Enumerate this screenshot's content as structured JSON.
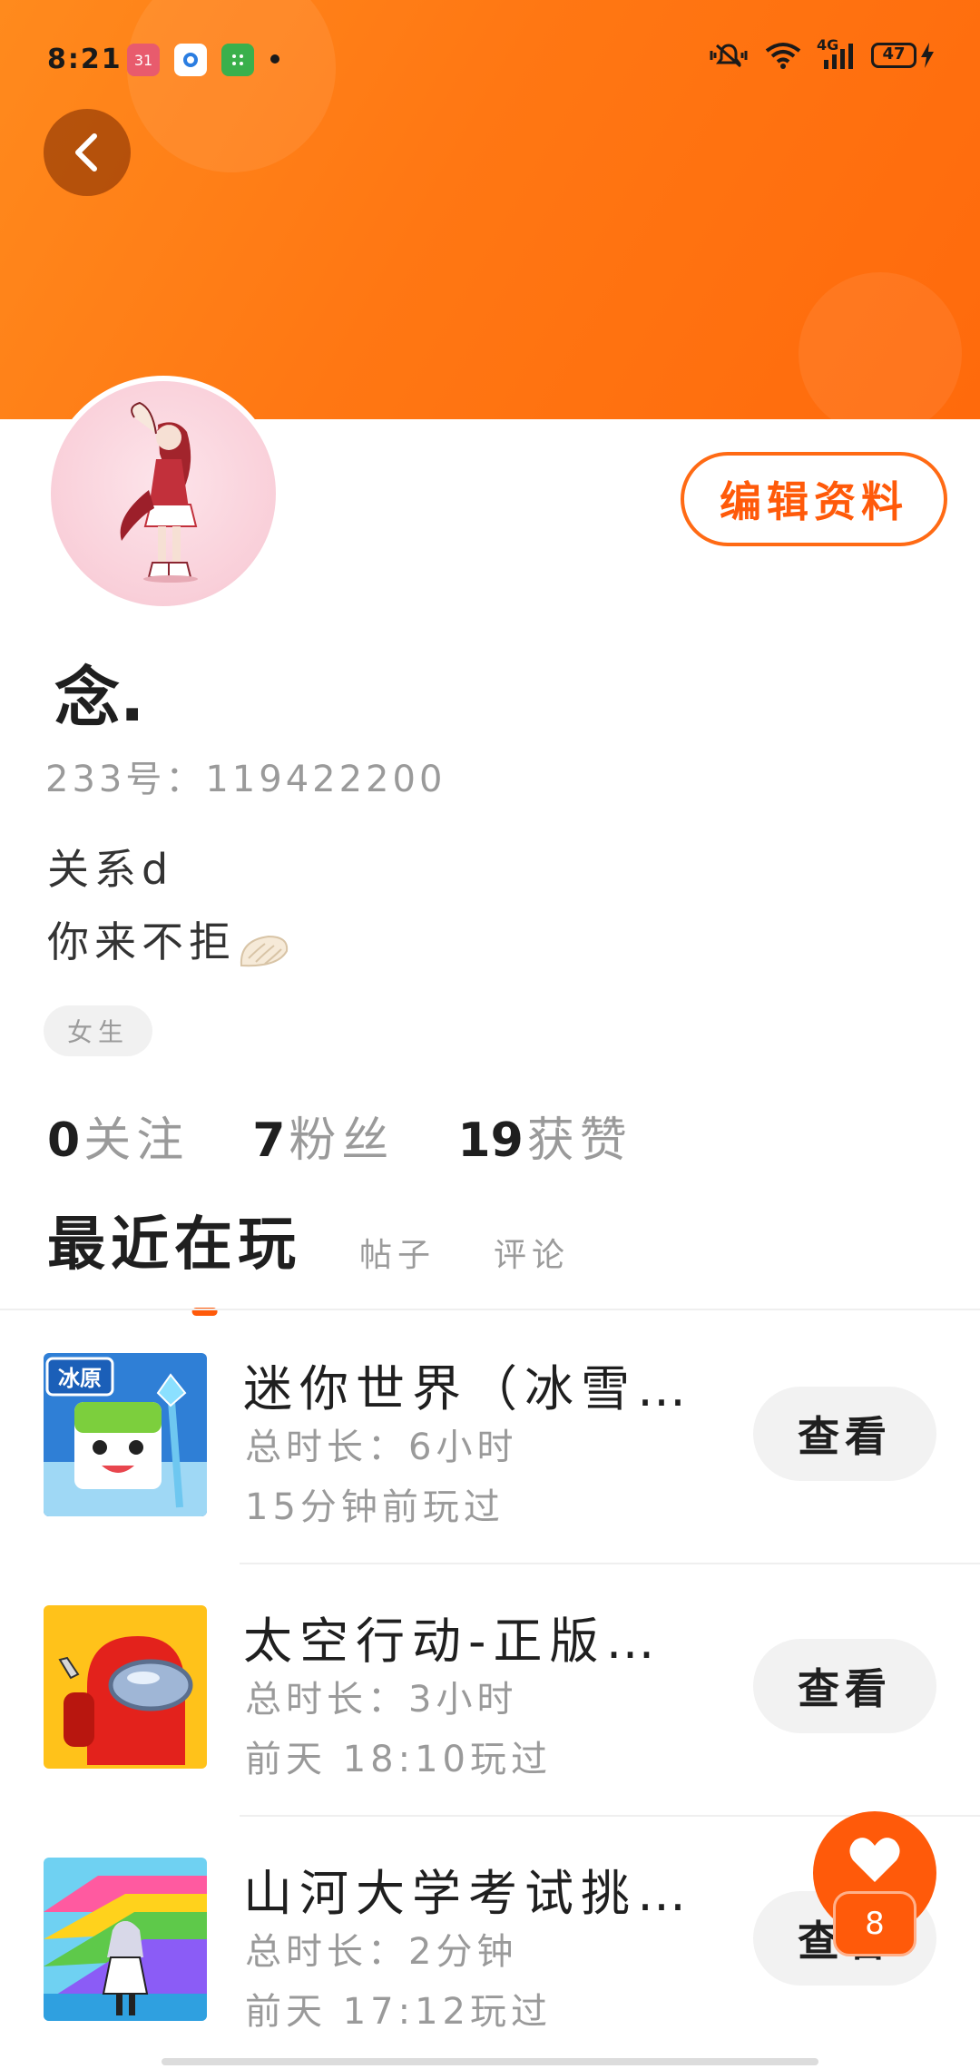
{
  "status_bar": {
    "time": "8:21",
    "calendar_badge": "31",
    "network": "4G",
    "battery": "47"
  },
  "profile": {
    "username": "念.",
    "id_label": "233号：",
    "id_value": "119422200",
    "bio_line1": "关系d",
    "bio_line2": "你来不拒",
    "gender": "女生",
    "edit_button": "编辑资料"
  },
  "stats": [
    {
      "value": "0",
      "label": "关注"
    },
    {
      "value": "7",
      "label": "粉丝"
    },
    {
      "value": "19",
      "label": "获赞"
    }
  ],
  "tabs": [
    {
      "label": "最近在玩",
      "active": true
    },
    {
      "label": "帖子",
      "active": false
    },
    {
      "label": "评论",
      "active": false
    }
  ],
  "games": [
    {
      "name": "迷你世界（冰雪…",
      "duration": "总时长：6小时",
      "last_played": "15分钟前玩过",
      "button": "查看",
      "icon": "mini-world-icon"
    },
    {
      "name": "太空行动-正版…",
      "duration": "总时长：3小时",
      "last_played": "前天 18:10玩过",
      "button": "查看",
      "icon": "space-action-icon"
    },
    {
      "name": "山河大学考试挑…",
      "duration": "总时长：2分钟",
      "last_played": "前天 17:12玩过",
      "button": "查看",
      "icon": "shanhe-university-icon"
    }
  ],
  "fab": {
    "badge_count": "8"
  },
  "colors": {
    "accent": "#ff5a0a",
    "banner": "#ff7713",
    "muted_text": "#9a9a9a"
  }
}
